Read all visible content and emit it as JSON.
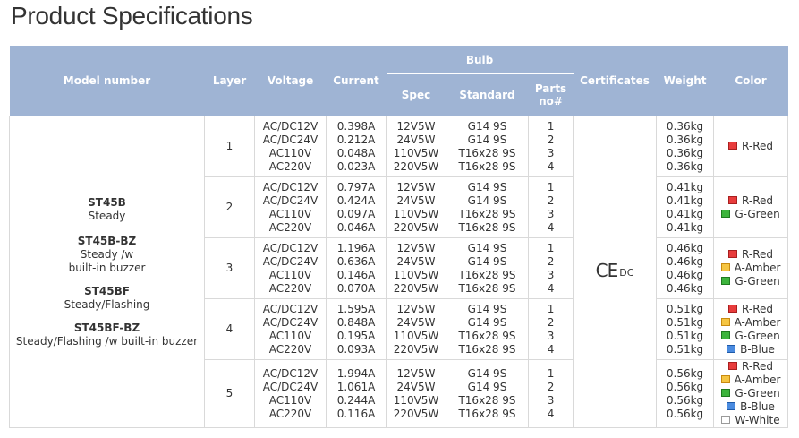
{
  "page": {
    "title": "Product Specifications"
  },
  "table": {
    "headers": {
      "model": "Model number",
      "layer": "Layer",
      "voltage": "Voltage",
      "current": "Current",
      "bulb": "Bulb",
      "spec": "Spec",
      "standard": "Standard",
      "parts": [
        "Parts",
        "no#"
      ],
      "certificates": "Certificates",
      "weight": "Weight",
      "color": "Color"
    },
    "models": [
      {
        "code": "ST45B",
        "desc": [
          "Steady"
        ]
      },
      {
        "code": "ST45B-BZ",
        "desc": [
          "Steady /w",
          "built-in buzzer"
        ]
      },
      {
        "code": "ST45BF",
        "desc": [
          "Steady/Flashing"
        ]
      },
      {
        "code": "ST45BF-BZ",
        "desc": [
          "Steady/Flashing /w built-in buzzer"
        ]
      }
    ],
    "certificate": {
      "ce": "CE",
      "dc": "DC"
    },
    "rows": [
      {
        "layer": "1",
        "voltage": [
          "AC/DC12V",
          "AC/DC24V",
          "AC110V",
          "AC220V"
        ],
        "current": [
          "0.398A",
          "0.212A",
          "0.048A",
          "0.023A"
        ],
        "spec": [
          "12V5W",
          "24V5W",
          "110V5W",
          "220V5W"
        ],
        "standard": [
          "G14 9S",
          "G14 9S",
          "T16x28 9S",
          "T16x28 9S"
        ],
        "parts": [
          "1",
          "2",
          "3",
          "4"
        ],
        "weight": [
          "0.36kg",
          "0.36kg",
          "0.36kg",
          "0.36kg"
        ],
        "colors": [
          {
            "label": "R-Red",
            "fill": "#e83c3c",
            "stroke": "#a81f1f"
          }
        ]
      },
      {
        "layer": "2",
        "voltage": [
          "AC/DC12V",
          "AC/DC24V",
          "AC110V",
          "AC220V"
        ],
        "current": [
          "0.797A",
          "0.424A",
          "0.097A",
          "0.046A"
        ],
        "spec": [
          "12V5W",
          "24V5W",
          "110V5W",
          "220V5W"
        ],
        "standard": [
          "G14 9S",
          "G14 9S",
          "T16x28 9S",
          "T16x28 9S"
        ],
        "parts": [
          "1",
          "2",
          "3",
          "4"
        ],
        "weight": [
          "0.41kg",
          "0.41kg",
          "0.41kg",
          "0.41kg"
        ],
        "colors": [
          {
            "label": "R-Red",
            "fill": "#e83c3c",
            "stroke": "#a81f1f"
          },
          {
            "label": "G-Green",
            "fill": "#3cb43c",
            "stroke": "#1f7a1f"
          }
        ]
      },
      {
        "layer": "3",
        "voltage": [
          "AC/DC12V",
          "AC/DC24V",
          "AC110V",
          "AC220V"
        ],
        "current": [
          "1.196A",
          "0.636A",
          "0.146A",
          "0.070A"
        ],
        "spec": [
          "12V5W",
          "24V5W",
          "110V5W",
          "220V5W"
        ],
        "standard": [
          "G14 9S",
          "G14 9S",
          "T16x28 9S",
          "T16x28 9S"
        ],
        "parts": [
          "1",
          "2",
          "3",
          "4"
        ],
        "weight": [
          "0.46kg",
          "0.46kg",
          "0.46kg",
          "0.46kg"
        ],
        "colors": [
          {
            "label": "R-Red",
            "fill": "#e83c3c",
            "stroke": "#a81f1f"
          },
          {
            "label": "A-Amber",
            "fill": "#f5c542",
            "stroke": "#c88a10"
          },
          {
            "label": "G-Green",
            "fill": "#3cb43c",
            "stroke": "#1f7a1f"
          }
        ]
      },
      {
        "layer": "4",
        "voltage": [
          "AC/DC12V",
          "AC/DC24V",
          "AC110V",
          "AC220V"
        ],
        "current": [
          "1.595A",
          "0.848A",
          "0.195A",
          "0.093A"
        ],
        "spec": [
          "12V5W",
          "24V5W",
          "110V5W",
          "220V5W"
        ],
        "standard": [
          "G14 9S",
          "G14 9S",
          "T16x28 9S",
          "T16x28 9S"
        ],
        "parts": [
          "1",
          "2",
          "3",
          "4"
        ],
        "weight": [
          "0.51kg",
          "0.51kg",
          "0.51kg",
          "0.51kg"
        ],
        "colors": [
          {
            "label": "R-Red",
            "fill": "#e83c3c",
            "stroke": "#a81f1f"
          },
          {
            "label": "A-Amber",
            "fill": "#f5c542",
            "stroke": "#c88a10"
          },
          {
            "label": "G-Green",
            "fill": "#3cb43c",
            "stroke": "#1f7a1f"
          },
          {
            "label": "B-Blue",
            "fill": "#4a8be0",
            "stroke": "#1f5aa8"
          }
        ]
      },
      {
        "layer": "5",
        "voltage": [
          "AC/DC12V",
          "AC/DC24V",
          "AC110V",
          "AC220V"
        ],
        "current": [
          "1.994A",
          "1.061A",
          "0.244A",
          "0.116A"
        ],
        "spec": [
          "12V5W",
          "24V5W",
          "110V5W",
          "220V5W"
        ],
        "standard": [
          "G14 9S",
          "G14 9S",
          "T16x28 9S",
          "T16x28 9S"
        ],
        "parts": [
          "1",
          "2",
          "3",
          "4"
        ],
        "weight": [
          "0.56kg",
          "0.56kg",
          "0.56kg",
          "0.56kg"
        ],
        "colors": [
          {
            "label": "R-Red",
            "fill": "#e83c3c",
            "stroke": "#a81f1f"
          },
          {
            "label": "A-Amber",
            "fill": "#f5c542",
            "stroke": "#c88a10"
          },
          {
            "label": "G-Green",
            "fill": "#3cb43c",
            "stroke": "#1f7a1f"
          },
          {
            "label": "B-Blue",
            "fill": "#4a8be0",
            "stroke": "#1f5aa8"
          },
          {
            "label": "W-White",
            "fill": "#ffffff",
            "stroke": "#9a9a9a"
          }
        ]
      }
    ]
  }
}
